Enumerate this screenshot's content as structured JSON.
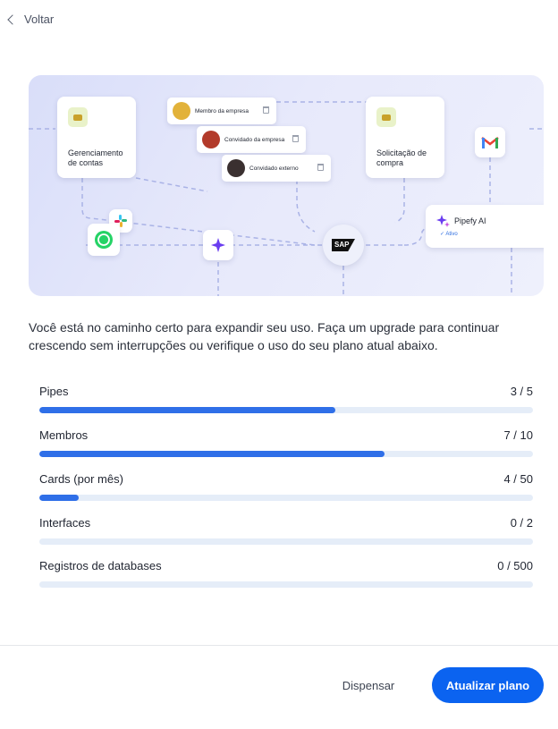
{
  "nav": {
    "back_label": "Voltar"
  },
  "illustration": {
    "card_accounts": "Gerenciamento de contas",
    "card_purchase": "Solicitação de compra",
    "member_1": "Membro da empresa",
    "member_2": "Convidado da empresa",
    "member_3": "Convidado externo",
    "sap_label": "SAP",
    "ai_title": "Pipefy AI",
    "ai_status": "✓ Ativo",
    "icons": [
      "whatsapp-icon",
      "slack-icon",
      "sparkle-icon",
      "gmail-icon",
      "sap-icon",
      "pipefy-ai-icon"
    ]
  },
  "description": "Você está no caminho certo para expandir seu uso. Faça um upgrade para continuar crescendo sem interrupções ou verifique o uso do seu plano atual abaixo.",
  "usage": [
    {
      "label": "Pipes",
      "value": "3 / 5",
      "used": 3,
      "limit": 5
    },
    {
      "label": "Membros",
      "value": "7 / 10",
      "used": 7,
      "limit": 10
    },
    {
      "label": "Cards (por mês)",
      "value": "4 / 50",
      "used": 4,
      "limit": 50
    },
    {
      "label": "Interfaces",
      "value": "0 / 2",
      "used": 0,
      "limit": 2
    },
    {
      "label": "Registros de databases",
      "value": "0 / 500",
      "used": 0,
      "limit": 500
    }
  ],
  "footer": {
    "dismiss_label": "Dispensar",
    "upgrade_label": "Atualizar plano"
  },
  "colors": {
    "accent": "#0b63f0",
    "bar_fill": "#2f6fe8",
    "bar_track": "#e5edf8"
  }
}
